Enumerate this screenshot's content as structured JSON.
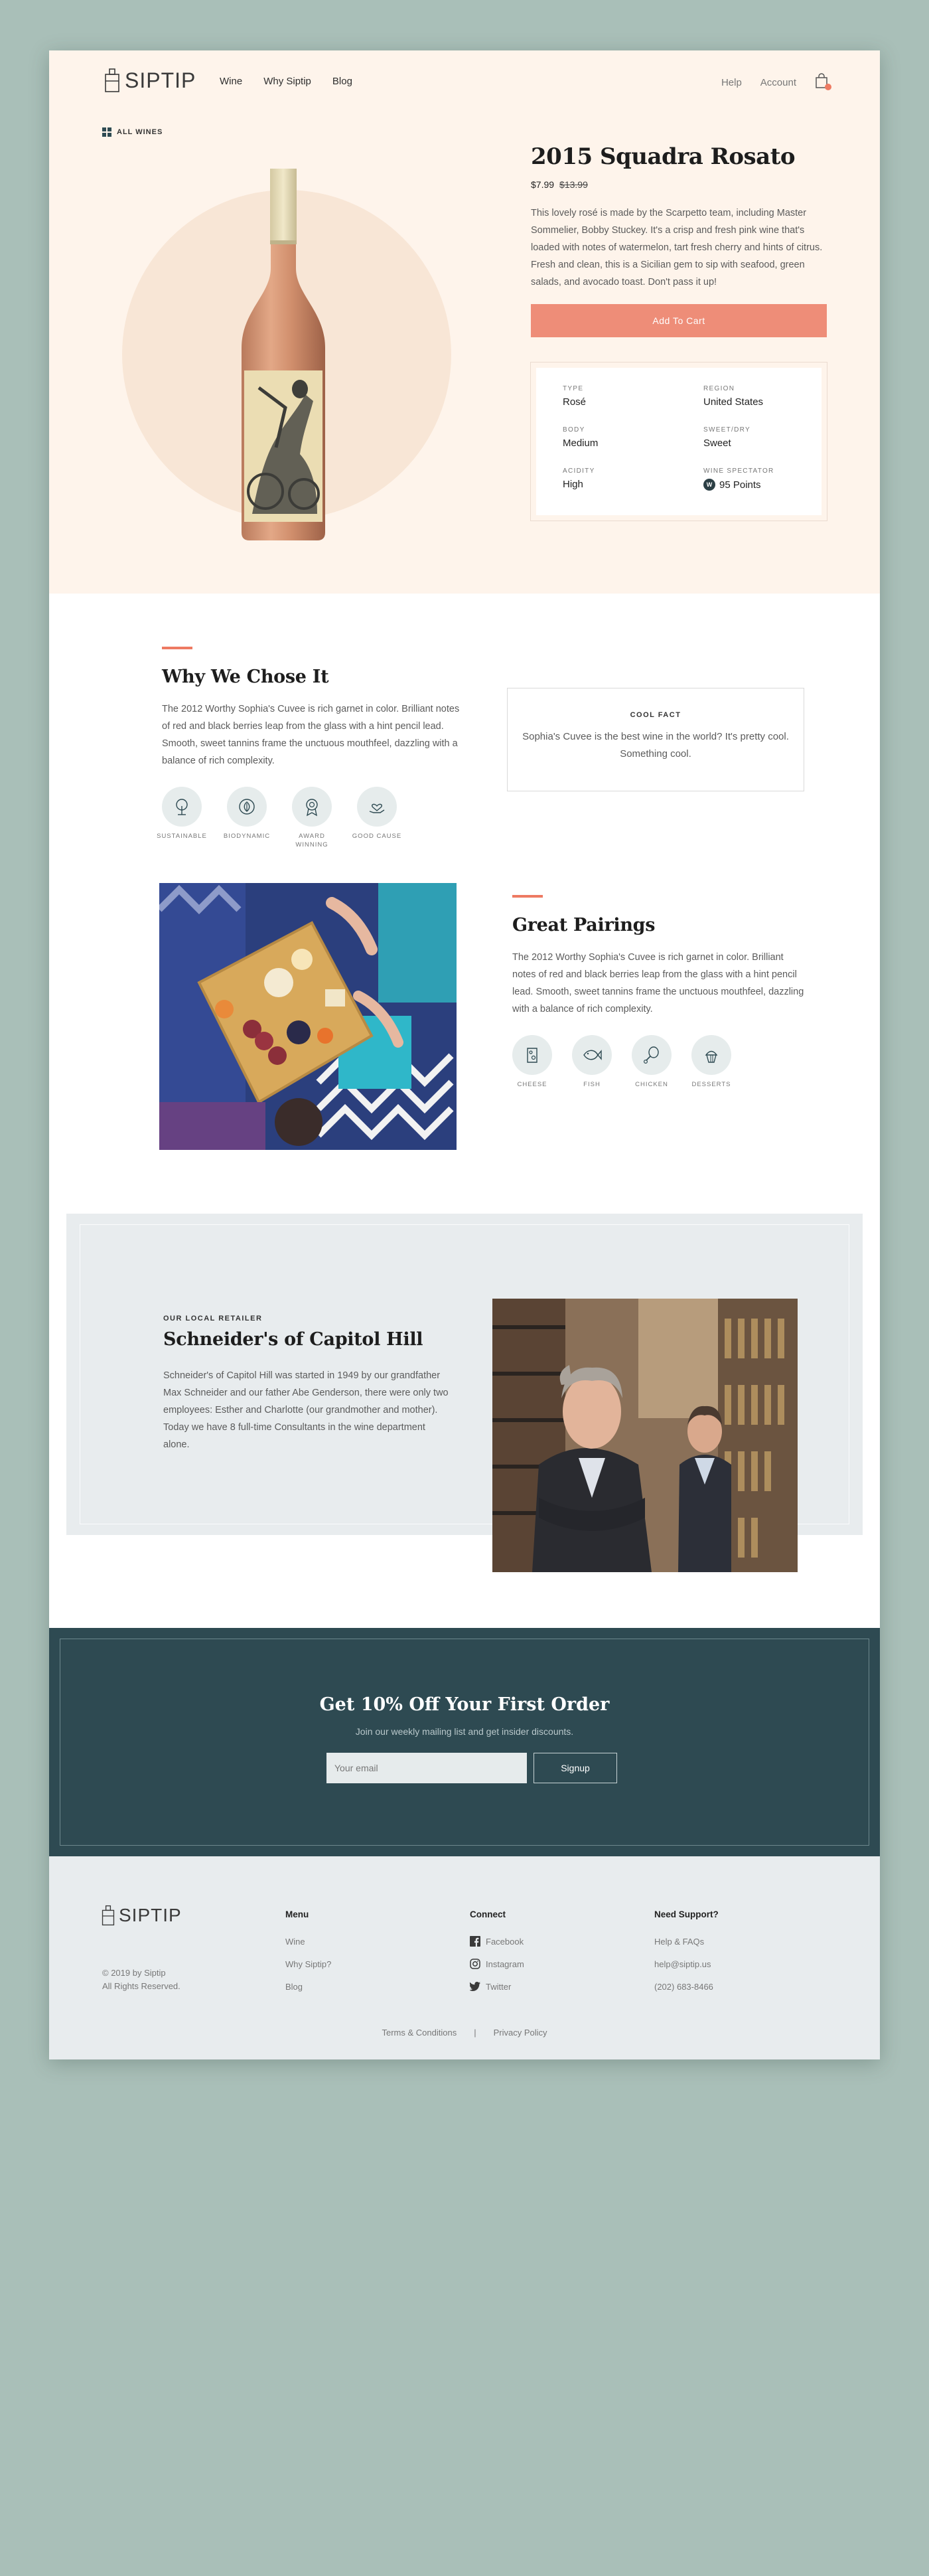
{
  "nav": {
    "logo_text": "SIPTIP",
    "links": [
      "Wine",
      "Why Siptip",
      "Blog"
    ],
    "help": "Help",
    "account": "Account",
    "cart_icon": "shopping-bag-icon"
  },
  "breadcrumb": {
    "all_wines": "ALL WINES"
  },
  "product": {
    "title": "2015 Squadra Rosato",
    "price": "$7.99",
    "old_price": "$13.99",
    "description": "This lovely rosé is made by the Scarpetto team, including Master Sommelier, Bobby Stuckey. It's a crisp and fresh pink wine that's loaded with notes of watermelon, tart fresh cherry and hints of citrus. Fresh and clean, this is a Sicilian gem to sip with seafood, green salads, and avocado toast. Don't pass it up!",
    "add_to_cart": "Add To Cart",
    "specs": [
      {
        "label": "TYPE",
        "value": "Rosé"
      },
      {
        "label": "REGION",
        "value": "United States"
      },
      {
        "label": "BODY",
        "value": "Medium"
      },
      {
        "label": "SWEET/DRY",
        "value": "Sweet"
      },
      {
        "label": "ACIDITY",
        "value": "High"
      },
      {
        "label": "WINE SPECTATOR",
        "value": "95 Points",
        "badge": "W"
      }
    ]
  },
  "why": {
    "title": "Why We Chose It",
    "text": "The 2012 Worthy Sophia's Cuvee is rich garnet in color. Brilliant notes of red and black berries leap from the glass with a hint pencil lead. Smooth, sweet tannins frame the unctuous mouthfeel, dazzling with a balance of rich complexity.",
    "badges": [
      "SUSTAINABLE",
      "BIODYNAMIC",
      "AWARD WINNING",
      "GOOD CAUSE"
    ]
  },
  "fact": {
    "label": "COOL FACT",
    "text": "Sophia's Cuvee is the best wine in the world? It's pretty cool. Something cool."
  },
  "pairings": {
    "title": "Great Pairings",
    "text": "The 2012 Worthy Sophia's Cuvee is rich garnet in color. Brilliant notes of red and black berries leap from the glass with a hint pencil lead. Smooth, sweet tannins frame the unctuous mouthfeel, dazzling with a balance of rich complexity.",
    "items": [
      "CHEESE",
      "FISH",
      "CHICKEN",
      "DESSERTS"
    ]
  },
  "retailer": {
    "kicker": "OUR LOCAL RETAILER",
    "title": "Schneider's of Capitol Hill",
    "text": "Schneider's of Capitol Hill was started in 1949 by our grandfather Max Schneider and our father Abe Genderson, there were only two employees: Esther and Charlotte (our grandmother and mother). Today we have 8 full-time Consultants in the wine department alone."
  },
  "newsletter": {
    "title": "Get 10% Off Your First Order",
    "subtitle": "Join our weekly mailing list and get insider discounts.",
    "email_placeholder": "Your email",
    "signup": "Signup"
  },
  "footer": {
    "logo_text": "SIPTIP",
    "copyright_1": "© 2019 by Siptip",
    "copyright_2": "All Rights Reserved.",
    "menu": {
      "head": "Menu",
      "links": [
        "Wine",
        "Why Siptip?",
        "Blog"
      ]
    },
    "connect": {
      "head": "Connect",
      "links": [
        "Facebook",
        "Instagram",
        "Twitter"
      ]
    },
    "support": {
      "head": "Need Support?",
      "links": [
        "Help & FAQs",
        "help@siptip.us",
        "(202) 683-8466"
      ]
    },
    "terms": "Terms & Conditions",
    "separator": "|",
    "privacy": "Privacy Policy"
  },
  "colors": {
    "background": "#a9bfb8",
    "hero": "#fef4eb",
    "accent": "#ee7a62",
    "button": "#ee8d78",
    "dark_teal": "#2e4a52",
    "light_gray": "#e8ecee"
  }
}
